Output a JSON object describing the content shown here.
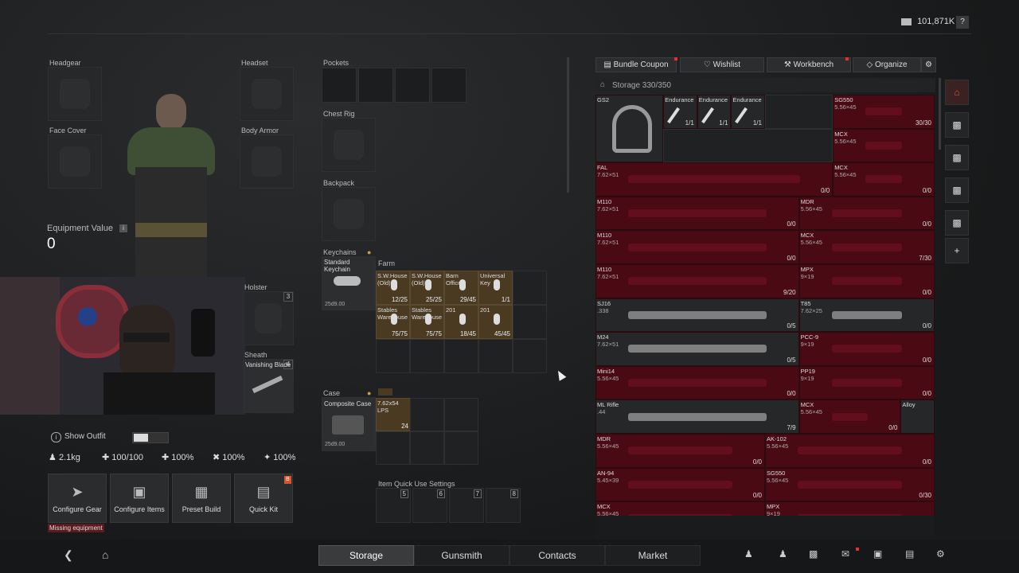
{
  "currency": {
    "amount": "101,871K",
    "help": "?"
  },
  "equipment": {
    "headgear": "Headgear",
    "headset": "Headset",
    "face_cover": "Face Cover",
    "body_armor": "Body Armor",
    "value_label": "Equipment Value",
    "value": "0",
    "info": "i"
  },
  "containers": {
    "pockets": "Pockets",
    "chest_rig": "Chest Rig",
    "backpack": "Backpack",
    "keychains": "Keychains",
    "keychain_item": "Standard Keychain",
    "keychain_time": "25d9.00",
    "holster": "Holster",
    "holster_count": "3",
    "sheath": "Sheath",
    "sheath_item": "Vanishing Blade",
    "sheath_count": "4",
    "farm_label": "Farm",
    "keys": [
      {
        "name": "S.W.House (Old)",
        "count": "12/25"
      },
      {
        "name": "S.W.House (Old)",
        "count": "25/25"
      },
      {
        "name": "Barn Office",
        "count": "29/45"
      },
      {
        "name": "Universal Key",
        "count": "1/1"
      },
      {
        "name": "Stables Warehouse",
        "count": "75/75"
      },
      {
        "name": "Stables Warehouse",
        "count": "75/75"
      },
      {
        "name": "201",
        "count": "18/45"
      },
      {
        "name": "201",
        "count": "45/45"
      }
    ],
    "case": "Case",
    "case_item": "Composite Case",
    "case_time": "25d9.00",
    "ammo_name": "7.62x54 LPS",
    "ammo_count": "24",
    "quick_use": "Item Quick Use Settings",
    "quick_slots": [
      "5",
      "6",
      "7",
      "8"
    ]
  },
  "outfit": {
    "label": "Show Outfit"
  },
  "stats": {
    "weight": "2.1kg",
    "s1": "100/100",
    "s2": "100%",
    "s3": "100%",
    "s4": "100%"
  },
  "actions": [
    {
      "label": "Configure Gear"
    },
    {
      "label": "Configure Items"
    },
    {
      "label": "Preset Build"
    },
    {
      "label": "Quick Kit",
      "badge": "B"
    }
  ],
  "warning": "Missing equipment",
  "storage_toolbar": {
    "bundle": "Bundle Coupon",
    "wishlist": "Wishlist",
    "workbench": "Workbench",
    "organize": "Organize"
  },
  "storage_header": "Storage 330/350",
  "storage_items": {
    "gs2": "GS2",
    "endurance": [
      "Endurance",
      "Endurance",
      "Endurance"
    ],
    "endurance_cnt": [
      "1/1",
      "1/1",
      "1/1"
    ],
    "sg550_top": {
      "name": "SG550",
      "cal": "5.56×45",
      "cnt": "30/30"
    },
    "mcx1": {
      "name": "MCX",
      "cal": "5.56×45"
    },
    "fal": {
      "name": "FAL",
      "cal": "7.62×51",
      "cnt": "0/0"
    },
    "mcx2": {
      "name": "MCX",
      "cal": "5.56×45",
      "cnt": "0/0"
    },
    "m110a": {
      "name": "M110",
      "cal": "7.62×51",
      "cnt": "0/0"
    },
    "mdr1": {
      "name": "MDR",
      "cal": "5.56×45",
      "cnt": "0/0"
    },
    "m110b": {
      "name": "M110",
      "cal": "7.62×51",
      "cnt": "0/0"
    },
    "mcx3": {
      "name": "MCX",
      "cal": "5.56×45",
      "cnt": "7/30"
    },
    "m110c": {
      "name": "M110",
      "cal": "7.62×51",
      "cnt": "9/20"
    },
    "mpx1": {
      "name": "MPX",
      "cal": "9×19",
      "cnt": "0/0"
    },
    "sj16": {
      "name": "SJ16",
      "cal": ".338",
      "cnt": "0/5"
    },
    "t85": {
      "name": "T85",
      "cal": "7.62×25",
      "cnt": "0/0"
    },
    "m24": {
      "name": "M24",
      "cal": "7.62×51",
      "cnt": "0/5"
    },
    "pcc9": {
      "name": "PCC-9",
      "cal": "9×19",
      "cnt": "0/0"
    },
    "mini14": {
      "name": "Mini14",
      "cal": "5.56×45",
      "cnt": "0/0"
    },
    "pp19": {
      "name": "PP19",
      "cal": "9×19",
      "cnt": "0/0"
    },
    "mlrifle": {
      "name": "ML Rifle",
      "cal": ".44",
      "cnt": "7/9"
    },
    "mcx4": {
      "name": "MCX",
      "cal": "5.56×45",
      "cnt": "0/0"
    },
    "alloy": {
      "name": "Alloy",
      "cnt": ""
    },
    "mdr2": {
      "name": "MDR",
      "cal": "5.56×45",
      "cnt": "0/0"
    },
    "ak102": {
      "name": "AK-102",
      "cal": "5.56×45",
      "cnt": "0/0"
    },
    "an94": {
      "name": "AN-94",
      "cal": "5.45×39",
      "cnt": "0/0"
    },
    "sg550b": {
      "name": "SG550",
      "cal": "5.56×45",
      "cnt": "0/30"
    },
    "mcx5": {
      "name": "MCX",
      "cal": "5.56×45"
    },
    "mpx2": {
      "name": "MPX",
      "cal": "9×19"
    }
  },
  "nav": {
    "tabs": [
      "Storage",
      "Gunsmith",
      "Contacts",
      "Market"
    ]
  }
}
